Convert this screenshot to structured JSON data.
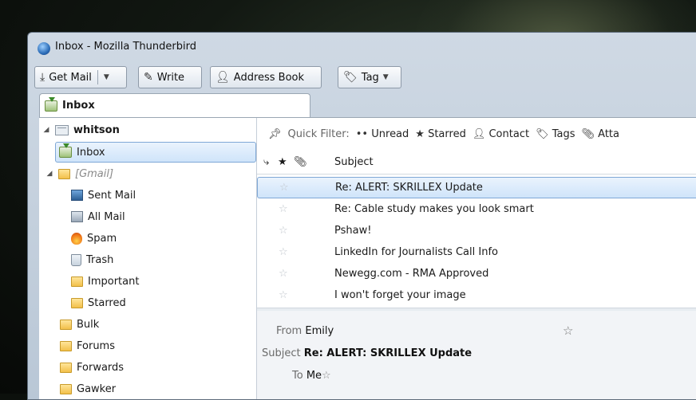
{
  "window": {
    "title": "Inbox - Mozilla Thunderbird"
  },
  "toolbar": {
    "get_mail": "Get Mail",
    "write": "Write",
    "address_book": "Address Book",
    "tag": "Tag"
  },
  "tab": {
    "label": "Inbox"
  },
  "folders": {
    "account": "whitson",
    "items": [
      {
        "label": "Inbox",
        "icon": "inbox-icon",
        "selected": true
      },
      {
        "label": "[Gmail]",
        "icon": "folder-icon"
      },
      {
        "label": "Sent Mail",
        "icon": "sent-mail-icon"
      },
      {
        "label": "All Mail",
        "icon": "all-mail-icon"
      },
      {
        "label": "Spam",
        "icon": "spam-icon"
      },
      {
        "label": "Trash",
        "icon": "trash-icon"
      },
      {
        "label": "Important",
        "icon": "folder-icon"
      },
      {
        "label": "Starred",
        "icon": "folder-icon"
      },
      {
        "label": "Bulk",
        "icon": "folder-icon"
      },
      {
        "label": "Forums",
        "icon": "folder-icon"
      },
      {
        "label": "Forwards",
        "icon": "folder-icon"
      },
      {
        "label": "Gawker",
        "icon": "folder-icon"
      }
    ]
  },
  "quick_filter": {
    "label": "Quick Filter:",
    "unread": "Unread",
    "starred": "Starred",
    "contact": "Contact",
    "tags": "Tags",
    "attachment": "Atta"
  },
  "message_list": {
    "subject_header": "Subject",
    "messages": [
      {
        "subject": "Re: ALERT: SKRILLEX Update",
        "selected": true
      },
      {
        "subject": "Re: Cable study makes you look smart"
      },
      {
        "subject": "Pshaw!"
      },
      {
        "subject": "LinkedIn for Journalists Call Info"
      },
      {
        "subject": "Newegg.com - RMA Approved"
      },
      {
        "subject": "I won't forget your image"
      }
    ]
  },
  "message_header": {
    "from_label": "From",
    "from_value": "Emily",
    "subject_label": "Subject",
    "subject_value": "Re: ALERT: SKRILLEX Update",
    "to_label": "To",
    "to_value": "Me"
  },
  "colors": {
    "selection": "#cfe4fa",
    "selection_border": "#7fa8d6",
    "window_chrome": "#c4d1de"
  }
}
